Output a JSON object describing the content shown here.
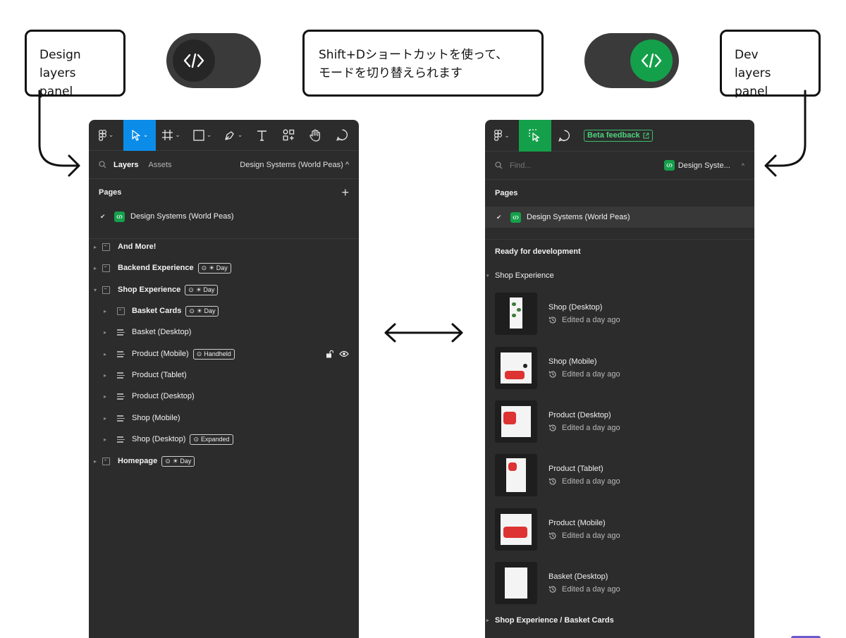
{
  "callouts": {
    "design": [
      "Design",
      "layers panel"
    ],
    "center": [
      "Shift+Dショートカットを使って、",
      "モードを切り替えられます"
    ],
    "dev": [
      "Dev",
      "layers panel"
    ]
  },
  "colors": {
    "accent_blue": "#0c8ce9",
    "dev_green": "#14a04a",
    "panel_bg": "#2c2c2c"
  },
  "design_panel": {
    "tabs": {
      "layers": "Layers",
      "assets": "Assets",
      "page_selector": "Design Systems (World Peas) ^"
    },
    "pages_label": "Pages",
    "add_page": "+",
    "current_page": "Design Systems (World Peas)",
    "check": "✔",
    "layers": [
      {
        "name": "And More!",
        "badge": ""
      },
      {
        "name": "Backend Experience",
        "badge": "☀ Day"
      },
      {
        "name": "Shop Experience",
        "badge": "☀ Day"
      },
      {
        "name": "Basket Cards",
        "badge": "☀ Day"
      },
      {
        "name": "Basket (Desktop)",
        "badge": ""
      },
      {
        "name": "Product (Mobile)",
        "badge": "Handheld"
      },
      {
        "name": "Product (Tablet)",
        "badge": ""
      },
      {
        "name": "Product (Desktop)",
        "badge": ""
      },
      {
        "name": "Shop (Mobile)",
        "badge": ""
      },
      {
        "name": "Shop (Desktop)",
        "badge": "Expanded"
      },
      {
        "name": "Homepage",
        "badge": "☀ Day"
      }
    ]
  },
  "dev_panel": {
    "beta_feedback": "Beta feedback",
    "find_placeholder": "Find...",
    "page_selector": "Design Syste...",
    "pages_label": "Pages",
    "current_page": "Design Systems (World Peas)",
    "check": "✔",
    "ready_label": "Ready for development",
    "group_label": "Shop Experience",
    "frames": [
      {
        "name": "Shop (Desktop)",
        "status": "Edited a day ago"
      },
      {
        "name": "Shop (Mobile)",
        "status": "Edited a day ago"
      },
      {
        "name": "Product (Desktop)",
        "status": "Edited a day ago"
      },
      {
        "name": "Product (Tablet)",
        "status": "Edited a day ago"
      },
      {
        "name": "Product (Mobile)",
        "status": "Edited a day ago"
      },
      {
        "name": "Basket (Desktop)",
        "status": "Edited a day ago"
      }
    ],
    "group2_label": "Shop Experience / Basket Cards"
  }
}
